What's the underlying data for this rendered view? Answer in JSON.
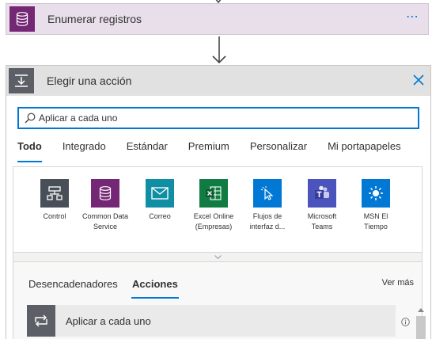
{
  "step": {
    "title": "Enumerar registros",
    "icon": "database-icon",
    "color": "#742774",
    "more_label": "⋯"
  },
  "chooser": {
    "title": "Elegir una acción",
    "icon": "download-step-icon",
    "search": {
      "value": "Aplicar a cada uno",
      "placeholder": ""
    },
    "tabs": [
      {
        "label": "Todo",
        "active": true
      },
      {
        "label": "Integrado",
        "active": false
      },
      {
        "label": "Estándar",
        "active": false
      },
      {
        "label": "Premium",
        "active": false
      },
      {
        "label": "Personalizar",
        "active": false
      },
      {
        "label": "Mi portapapeles",
        "active": false
      }
    ],
    "connectors": [
      {
        "name": "Control",
        "color": "#484f58",
        "icon": "control-icon"
      },
      {
        "name": "Common Data Service",
        "color": "#742774",
        "icon": "database-icon"
      },
      {
        "name": "Correo",
        "color": "#0f8ea4",
        "icon": "mail-icon"
      },
      {
        "name": "Excel Online (Empresas)",
        "color": "#107c41",
        "icon": "excel-icon"
      },
      {
        "name": "Flujos de interfaz d...",
        "color": "#0078d4",
        "icon": "cursor-icon"
      },
      {
        "name": "Microsoft Teams",
        "color": "#4b53bc",
        "icon": "teams-icon"
      },
      {
        "name": "MSN El Tiempo",
        "color": "#0078d4",
        "icon": "sun-icon"
      }
    ],
    "subtabs": [
      {
        "label": "Desencadenadores",
        "active": false
      },
      {
        "label": "Acciones",
        "active": true
      }
    ],
    "see_more": "Ver más",
    "actions": [
      {
        "label": "Aplicar a cada uno",
        "icon": "loop-icon"
      }
    ]
  },
  "colors": {
    "accent": "#0078d4",
    "header_bg": "#e1e1e1",
    "step_bg": "#e8dfeb"
  }
}
